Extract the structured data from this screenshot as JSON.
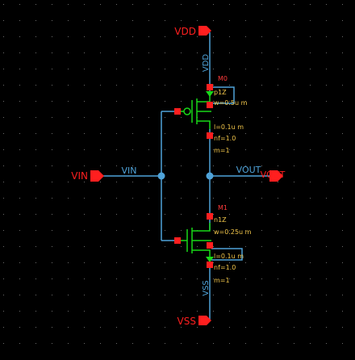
{
  "schematic": {
    "pins": {
      "vdd": "VDD",
      "vss": "VSS",
      "vin": "VIN",
      "vout": "VOUT"
    },
    "nets": {
      "vdd": "VDD",
      "vss": "VSS",
      "vin": "VIN",
      "vout": "VOUT"
    },
    "pmos": {
      "name": "M0",
      "model": "p1Z",
      "w": "w=0.5u m",
      "l": "l=0.1u m",
      "nf": "nf=1.0",
      "m": "m=1"
    },
    "nmos": {
      "name": "M1",
      "model": "n1Z",
      "w": "w=0.25u m",
      "l": "l=0.1u m",
      "nf": "nf=1.0",
      "m": "m=1"
    }
  },
  "colors": {
    "background": "#000000",
    "wire": "#4fa3d9",
    "pin": "#ff1f1f",
    "device": "#19d819",
    "label": "#f2c64a",
    "grid": "#6a6a6a"
  }
}
